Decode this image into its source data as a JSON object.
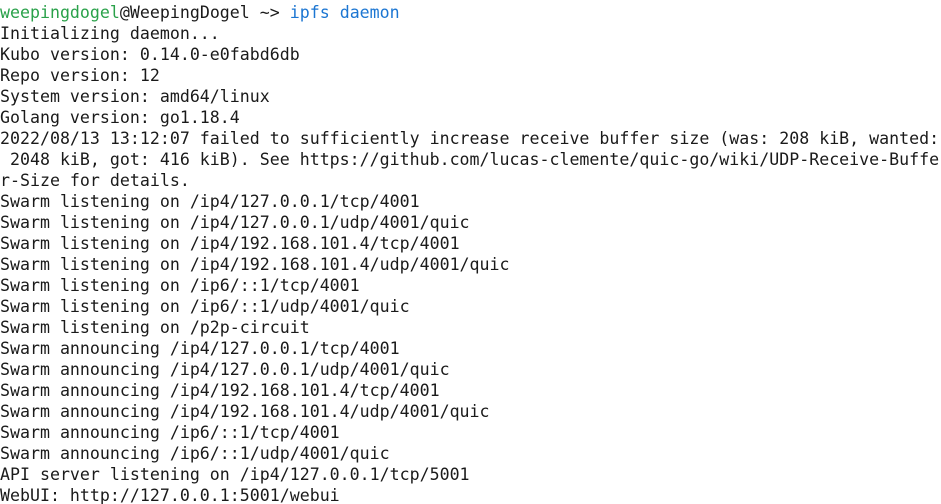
{
  "colors": {
    "background": "#ffffff",
    "text": "#1a1a1a",
    "prompt_user": "#2aa14a",
    "command": "#1c76d2"
  },
  "prompt": {
    "user": "weepingdogel",
    "at": "@",
    "host": "WeepingDogel",
    "path_sep": " ~> ",
    "command": "ipfs daemon"
  },
  "output": [
    "Initializing daemon...",
    "Kubo version: 0.14.0-e0fabd6db",
    "Repo version: 12",
    "System version: amd64/linux",
    "Golang version: go1.18.4",
    "2022/08/13 13:12:07 failed to sufficiently increase receive buffer size (was: 208 kiB, wanted:",
    " 2048 kiB, got: 416 kiB). See https://github.com/lucas-clemente/quic-go/wiki/UDP-Receive-Buffe",
    "r-Size for details.",
    "Swarm listening on /ip4/127.0.0.1/tcp/4001",
    "Swarm listening on /ip4/127.0.0.1/udp/4001/quic",
    "Swarm listening on /ip4/192.168.101.4/tcp/4001",
    "Swarm listening on /ip4/192.168.101.4/udp/4001/quic",
    "Swarm listening on /ip6/::1/tcp/4001",
    "Swarm listening on /ip6/::1/udp/4001/quic",
    "Swarm listening on /p2p-circuit",
    "Swarm announcing /ip4/127.0.0.1/tcp/4001",
    "Swarm announcing /ip4/127.0.0.1/udp/4001/quic",
    "Swarm announcing /ip4/192.168.101.4/tcp/4001",
    "Swarm announcing /ip4/192.168.101.4/udp/4001/quic",
    "Swarm announcing /ip6/::1/tcp/4001",
    "Swarm announcing /ip6/::1/udp/4001/quic",
    "API server listening on /ip4/127.0.0.1/tcp/5001",
    "WebUI: http://127.0.0.1:5001/webui"
  ]
}
